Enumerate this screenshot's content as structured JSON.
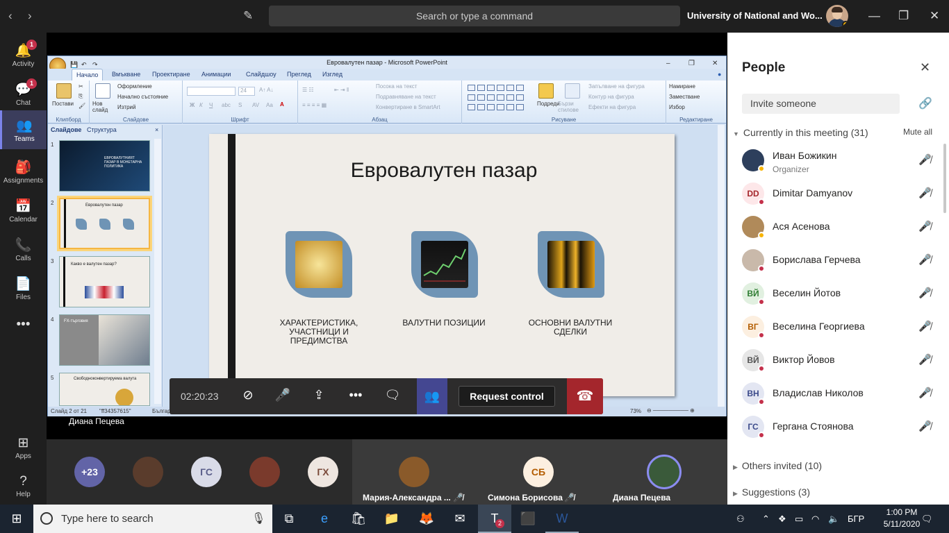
{
  "topbar": {
    "search_placeholder": "Search or type a command",
    "org": "University of National and Wo... ⌄"
  },
  "rail": [
    {
      "label": "Activity",
      "badge": "1"
    },
    {
      "label": "Chat",
      "badge": "1"
    },
    {
      "label": "Teams"
    },
    {
      "label": "Assignments"
    },
    {
      "label": "Calendar"
    },
    {
      "label": "Calls"
    },
    {
      "label": "Files"
    },
    {
      "label": "Apps"
    },
    {
      "label": "Help"
    }
  ],
  "ppt": {
    "title": "Евровалутен пазар - Microsoft PowerPoint",
    "tabs": [
      "Начало",
      "Вмъкване",
      "Проектиране",
      "Анимации",
      "Слайдшоу",
      "Преглед",
      "Изглед"
    ],
    "groups": [
      "Клипборд",
      "Слайдове",
      "Шрифт",
      "Абзац",
      "Рисуване",
      "Редактиране"
    ],
    "buttons": {
      "paste": "Постави",
      "new_slide": "Нов слайд",
      "layout": "Оформление",
      "reset": "Начално състояние",
      "delete": "Изтрий",
      "font_size": "24",
      "text_dir": "Посока на текст",
      "align_text": "Подравняване на текст",
      "smartart": "Конвертиране в SmartArt",
      "arrange": "Подреди",
      "quick_styles": "Бързи стилове",
      "shape_fill": "Запълване на фигура",
      "shape_outline": "Контур на фигура",
      "shape_effects": "Ефекти на фигура",
      "find": "Намиране",
      "replace": "Заместване",
      "select": "Избор"
    },
    "pane_tabs": [
      "Слайдове",
      "Структура"
    ],
    "thumbs": [
      {
        "num": "1",
        "text": "ЕВРОВАЛУТНИЯТ ПАЗАР В МОНЕТАРНА ПОЛИТИКА"
      },
      {
        "num": "2",
        "text": "Евровалутен пазар"
      },
      {
        "num": "3",
        "text": "Какво е валутен пазар?"
      },
      {
        "num": "4",
        "text": "FX-търговия"
      },
      {
        "num": "5",
        "text": "Свободноконвертируема валута"
      }
    ],
    "slide": {
      "title": "Евровалутен пазар",
      "cards": [
        "ХАРАКТЕРИСТИКА, УЧАСТНИЦИ И ПРЕДИМСТВА",
        "ВАЛУТНИ ПОЗИЦИИ",
        "ОСНОВНИ ВАЛУТНИ СДЕЛКИ"
      ]
    },
    "status": {
      "slide": "Слайд 2 от 21",
      "theme": "\"ff34357615\"",
      "lang": "Българ",
      "zoom": "73%"
    }
  },
  "call": {
    "timer": "02:20:23",
    "request_control": "Request control",
    "presenter": "Диана Пецева"
  },
  "gallery": {
    "more": "+23",
    "initials": [
      "ГС",
      "ГХ"
    ],
    "tiles": [
      {
        "name": "Мария-Александра ...",
        "mic": "🎤̸"
      },
      {
        "name": "Симона Борисова",
        "initials": "СБ",
        "mic": "🎤̸"
      },
      {
        "name": "Диана Пецева"
      }
    ]
  },
  "people": {
    "title": "People",
    "invite_placeholder": "Invite someone",
    "current": "Currently in this meeting (31)",
    "mute_all": "Mute all",
    "list": [
      {
        "name": "Иван Божикин",
        "role": "Organizer",
        "initials": "",
        "color": "#2d3f5c",
        "status": "away"
      },
      {
        "name": "Dimitar Damyanov",
        "initials": "DD",
        "color": "#fde7e9",
        "fg": "#a4262c",
        "status": "busy"
      },
      {
        "name": "Ася Асенова",
        "initials": "",
        "color": "#b08a5a",
        "status": "away"
      },
      {
        "name": "Борислава Герчева",
        "initials": "",
        "color": "#c9b9aa",
        "status": "busy"
      },
      {
        "name": "Веселин Йотов",
        "initials": "ВЙ",
        "color": "#e1f0e0",
        "fg": "#2e7d32",
        "status": "busy"
      },
      {
        "name": "Веселина Георгиева",
        "initials": "ВГ",
        "color": "#fcefe0",
        "fg": "#b35c00",
        "status": "busy"
      },
      {
        "name": "Виктор Йовов",
        "initials": "ВЙ",
        "color": "#e6e6e6",
        "fg": "#555",
        "status": "busy"
      },
      {
        "name": "Владислав Николов",
        "initials": "ВН",
        "color": "#e3e6f2",
        "fg": "#3b4a8a",
        "status": "busy"
      },
      {
        "name": "Гергана Стоянова",
        "initials": "ГС",
        "color": "#e3e6f2",
        "fg": "#3b4a8a",
        "status": "busy"
      }
    ],
    "others": "Others invited (10)",
    "suggestions": "Suggestions (3)"
  },
  "taskbar": {
    "search": "Type here to search",
    "lang": "БГР",
    "time": "1:00 PM",
    "date": "5/11/2020",
    "teams_badge": "2"
  }
}
